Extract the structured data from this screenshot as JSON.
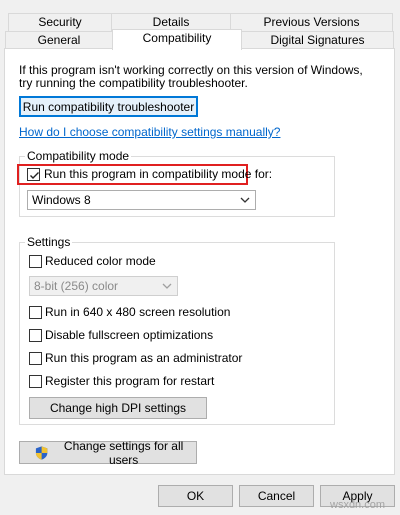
{
  "tabs": {
    "row1": [
      "Security",
      "Details",
      "Previous Versions"
    ],
    "row2": [
      "General",
      "Compatibility",
      "Digital Signatures"
    ],
    "active": "Compatibility"
  },
  "intro": {
    "line1": "If this program isn't working correctly on this version of Windows,",
    "line2": "try running the compatibility troubleshooter."
  },
  "buttons": {
    "troubleshooter": "Run compatibility troubleshooter",
    "high_dpi": "Change high DPI settings",
    "all_users": "Change settings for all users",
    "ok": "OK",
    "cancel": "Cancel",
    "apply": "Apply"
  },
  "help_link": "How do I choose compatibility settings manually?",
  "compat_mode": {
    "group_label": "Compatibility mode",
    "checkbox_label": "Run this program in compatibility mode for:",
    "checked": true,
    "selected": "Windows 8"
  },
  "settings": {
    "group_label": "Settings",
    "reduced_color": {
      "label": "Reduced color mode",
      "checked": false
    },
    "color_combo": "8-bit (256) color",
    "res_640": {
      "label": "Run in 640 x 480 screen resolution",
      "checked": false
    },
    "disable_fullscreen": {
      "label": "Disable fullscreen optimizations",
      "checked": false
    },
    "run_admin": {
      "label": "Run this program as an administrator",
      "checked": false
    },
    "register_restart": {
      "label": "Register this program for restart",
      "checked": false
    }
  },
  "watermark": "wsxdn.com",
  "colors": {
    "accent": "#0078d7",
    "link": "#0066cc",
    "highlight": "#e02020"
  }
}
